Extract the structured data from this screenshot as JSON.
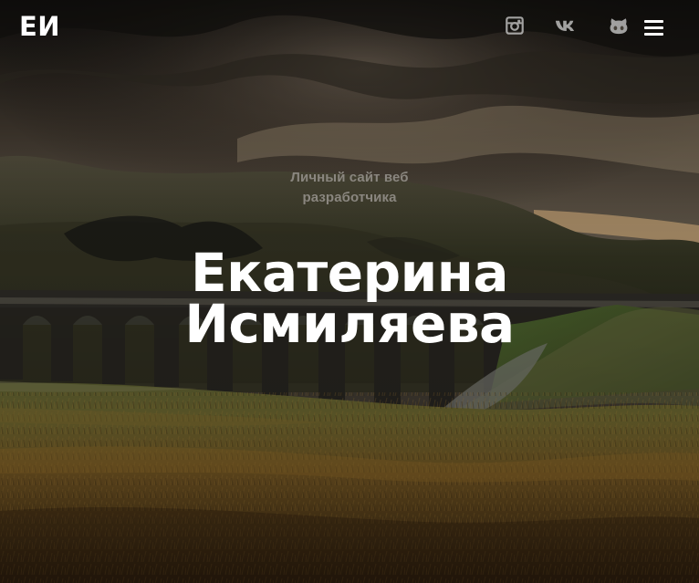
{
  "header": {
    "logo": "ЕИ",
    "social": [
      {
        "name": "Instagram",
        "icon": "instagram-icon"
      },
      {
        "name": "VK",
        "icon": "vk-icon"
      },
      {
        "name": "GitHub",
        "icon": "github-icon"
      }
    ],
    "menu_icon": "hamburger-menu-icon"
  },
  "hero": {
    "subtitle_line1": "Личный сайт веб",
    "subtitle_line2": "разработчика",
    "name_line1": "Екатерина",
    "name_line2": "Исмиляева"
  },
  "colors": {
    "text": "#ffffff",
    "muted_text": "#8a867f",
    "background": "#2a241d"
  }
}
